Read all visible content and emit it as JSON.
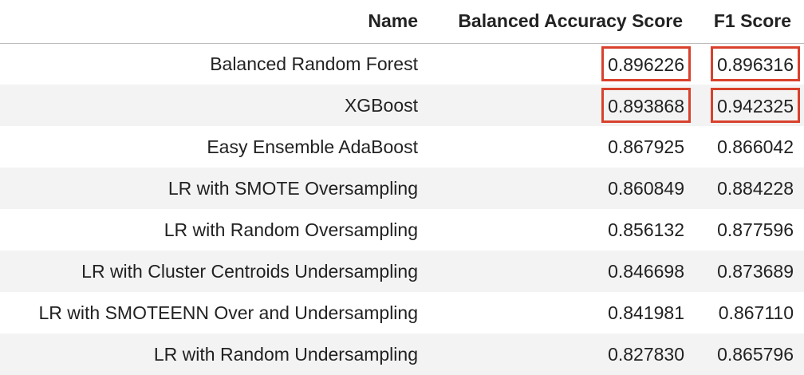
{
  "table": {
    "columns": [
      "Name",
      "Balanced Accuracy Score",
      "F1 Score"
    ],
    "rows": [
      {
        "name": "Balanced Random Forest",
        "balanced_accuracy": "0.896226",
        "f1": "0.896316",
        "highlight": true
      },
      {
        "name": "XGBoost",
        "balanced_accuracy": "0.893868",
        "f1": "0.942325",
        "highlight": true
      },
      {
        "name": "Easy Ensemble AdaBoost",
        "balanced_accuracy": "0.867925",
        "f1": "0.866042",
        "highlight": false
      },
      {
        "name": "LR with SMOTE Oversampling",
        "balanced_accuracy": "0.860849",
        "f1": "0.884228",
        "highlight": false
      },
      {
        "name": "LR with Random Oversampling",
        "balanced_accuracy": "0.856132",
        "f1": "0.877596",
        "highlight": false
      },
      {
        "name": "LR with Cluster Centroids Undersampling",
        "balanced_accuracy": "0.846698",
        "f1": "0.873689",
        "highlight": false
      },
      {
        "name": "LR with SMOTEENN Over and Undersampling",
        "balanced_accuracy": "0.841981",
        "f1": "0.867110",
        "highlight": false
      },
      {
        "name": "LR with Random Undersampling",
        "balanced_accuracy": "0.827830",
        "f1": "0.865796",
        "highlight": false
      }
    ]
  },
  "colors": {
    "highlight_border": "#d9412c",
    "stripe": "#f3f3f3",
    "header_rule": "#bdbdbd"
  }
}
